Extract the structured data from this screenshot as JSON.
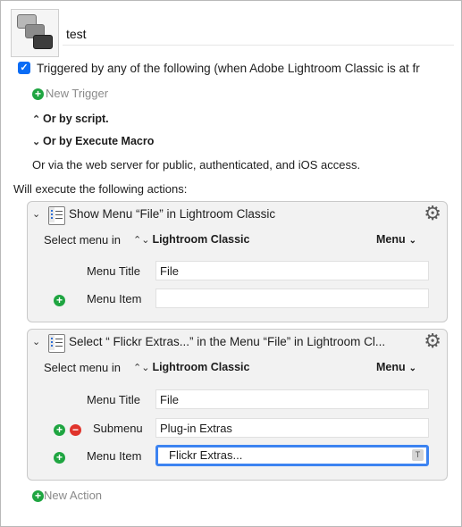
{
  "macro": {
    "name": "test",
    "trigger_checkbox_label": "Triggered by any of the following (when Adobe Lightroom Classic is at fr",
    "new_trigger_label": "New Trigger",
    "or_by_script": "Or by script.",
    "or_by_execute_macro": "Or by Execute Macro",
    "or_via_web": "Or via the web server for public, authenticated, and iOS access.",
    "will_execute": "Will execute the following actions:",
    "new_action_label": "New Action"
  },
  "actions": [
    {
      "title": "Show Menu “File” in Lightroom Classic",
      "select_menu_label": "Select menu in",
      "app": "Lightroom Classic",
      "menu_popup": "Menu",
      "fields": [
        {
          "label": "Menu Title",
          "value": "File"
        },
        {
          "label": "Menu Item",
          "value": ""
        }
      ]
    },
    {
      "title": "Select “   Flickr Extras...” in the Menu “File” in Lightroom Cl...",
      "select_menu_label": "Select menu in",
      "app": "Lightroom Classic",
      "menu_popup": "Menu",
      "fields": [
        {
          "label": "Menu Title",
          "value": "File"
        },
        {
          "label": "Submenu",
          "value": "Plug-in Extras"
        },
        {
          "label": "Menu Item",
          "value": "Flickr Extras..."
        }
      ],
      "token_badge": "T"
    }
  ],
  "colors": {
    "accent_blue": "#0a6cf5",
    "add_green": "#1fa541",
    "remove_red": "#e0342c",
    "focus_ring": "#3c83f1"
  },
  "icons": {
    "disclosure_open": "▾",
    "popup_arrows": "◇",
    "gear": "⚙"
  }
}
